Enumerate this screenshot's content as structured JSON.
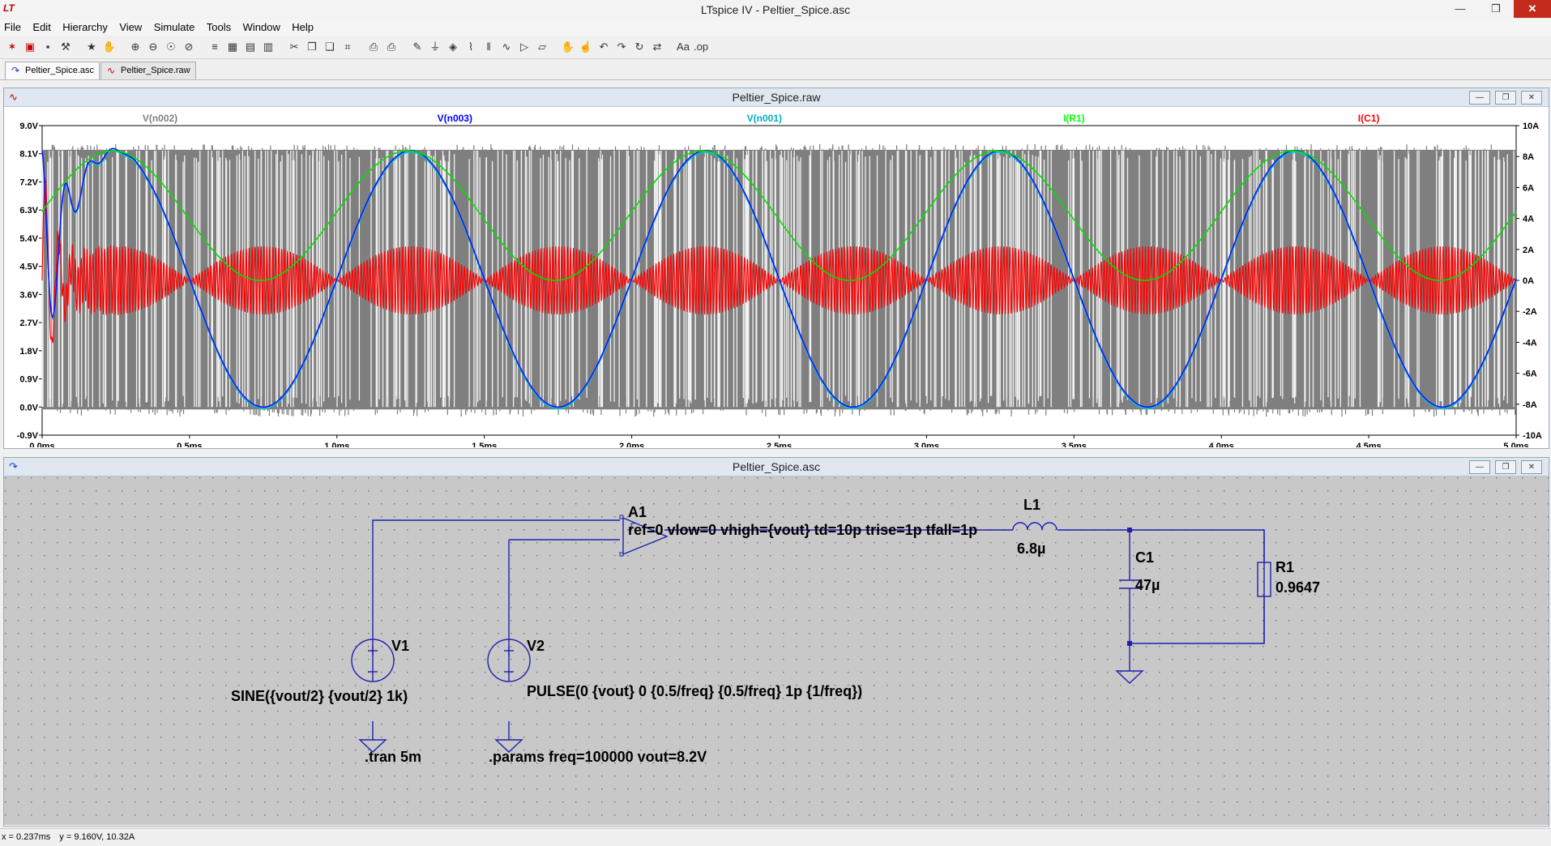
{
  "app": {
    "title": "LTspice IV - Peltier_Spice.asc"
  },
  "menu": [
    "File",
    "Edit",
    "Hierarchy",
    "View",
    "Simulate",
    "Tools",
    "Window",
    "Help"
  ],
  "toolbar_icons": [
    "new-schematic-icon",
    "open-icon",
    "save-icon",
    "control-panel-icon",
    "run-icon",
    "halt-icon",
    "zoom-in-icon",
    "zoom-out-icon",
    "zoom-full-icon",
    "zoom-cancel-icon",
    "autorange-icon",
    "tile-icon",
    "cascade-icon",
    "close-windows-icon",
    "cut-icon",
    "copy-icon",
    "paste-icon",
    "find-icon",
    "print-preview-icon",
    "print-icon",
    "draw-wire-icon",
    "ground-icon",
    "label-net-icon",
    "resistor-icon",
    "capacitor-icon",
    "inductor-icon",
    "diode-icon",
    "component-icon",
    "move-icon",
    "drag-icon",
    "undo-icon",
    "redo-icon",
    "rotate-icon",
    "mirror-icon",
    "text-icon",
    "spice-directive-icon"
  ],
  "tabs": [
    {
      "label": "Peltier_Spice.asc",
      "icon": "schematic-icon"
    },
    {
      "label": "Peltier_Spice.raw",
      "icon": "waveform-icon"
    }
  ],
  "waveform_window": {
    "title": "Peltier_Spice.raw"
  },
  "schematic_window": {
    "title": "Peltier_Spice.asc"
  },
  "chart_data": {
    "type": "line",
    "traces": [
      {
        "name": "V(n002)",
        "color": "#808080",
        "axis": "left",
        "description_values": "square wave switching 0 to 8.2"
      },
      {
        "name": "V(n003)",
        "color": "#0000ff",
        "axis": "left"
      },
      {
        "name": "V(n001)",
        "color": "#00c0c0",
        "axis": "left"
      },
      {
        "name": "I(R1)",
        "color": "#00ff00",
        "axis": "right"
      },
      {
        "name": "I(C1)",
        "color": "#ff0000",
        "axis": "right"
      }
    ],
    "x_ticks": [
      "0.0ms",
      "0.5ms",
      "1.0ms",
      "1.5ms",
      "2.0ms",
      "2.5ms",
      "3.0ms",
      "3.5ms",
      "4.0ms",
      "4.5ms",
      "5.0ms"
    ],
    "y_left_ticks": [
      "9.0V",
      "8.1V",
      "7.2V",
      "6.3V",
      "5.4V",
      "4.5V",
      "3.6V",
      "2.7V",
      "1.8V",
      "0.9V",
      "0.0V",
      "-0.9V"
    ],
    "y_right_ticks": [
      "10A",
      "8A",
      "6A",
      "4A",
      "2A",
      "0A",
      "-2A",
      "-4A",
      "-6A",
      "-8A",
      "-10A"
    ],
    "xlim": [
      0,
      5
    ],
    "ylim_left": [
      -0.9,
      9.0
    ],
    "ylim_right": [
      -10,
      10
    ],
    "sine_freq_khz": 1,
    "vout": 8.2,
    "grid": false
  },
  "schematic": {
    "a1_name": "A1",
    "a1_params": "ref=0 vlow=0 vhigh={vout} td=10p trise=1p tfall=1p",
    "l1_name": "L1",
    "l1_value": "6.8µ",
    "c1_name": "C1",
    "c1_value": "47µ",
    "r1_name": "R1",
    "r1_value": "0.9647",
    "v1_name": "V1",
    "v1_value": "SINE({vout/2} {vout/2} 1k)",
    "v2_name": "V2",
    "v2_value": "PULSE(0 {vout} 0 {0.5/freq} {0.5/freq} 1p {1/freq})",
    "tran_directive": ".tran 5m",
    "params_directive": ".params freq=100000 vout=8.2V"
  },
  "status": {
    "x_readout": "x = 0.237ms",
    "y_readout": "y = 9.160V, 10.32A"
  }
}
